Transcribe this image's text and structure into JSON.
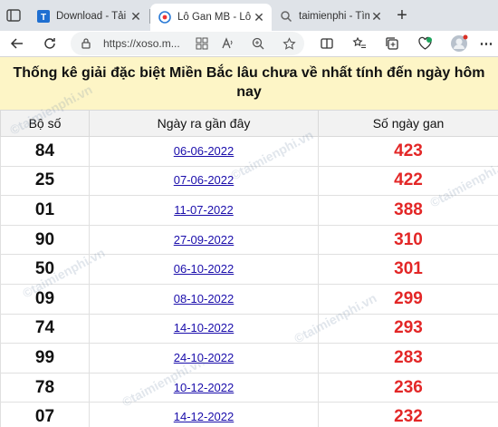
{
  "browser": {
    "tabs": [
      {
        "title": "Download - Tải M",
        "active": false
      },
      {
        "title": "Lô Gan MB - Lô G",
        "active": true
      },
      {
        "title": "taimienphi - Tìm k",
        "active": false
      }
    ],
    "new_tab_label": "+",
    "url": "https://xoso.m..."
  },
  "page": {
    "heading": "Thống kê giải đặc biệt Miền Bắc lâu chưa về nhất tính đến ngày hôm nay",
    "columns": [
      "Bộ số",
      "Ngày ra gần đây",
      "Số ngày gan"
    ],
    "rows": [
      {
        "number": "84",
        "date": "06-06-2022",
        "days": "423"
      },
      {
        "number": "25",
        "date": "07-06-2022",
        "days": "422"
      },
      {
        "number": "01",
        "date": "11-07-2022",
        "days": "388"
      },
      {
        "number": "90",
        "date": "27-09-2022",
        "days": "310"
      },
      {
        "number": "50",
        "date": "06-10-2022",
        "days": "301"
      },
      {
        "number": "09",
        "date": "08-10-2022",
        "days": "299"
      },
      {
        "number": "74",
        "date": "14-10-2022",
        "days": "293"
      },
      {
        "number": "99",
        "date": "24-10-2022",
        "days": "283"
      },
      {
        "number": "78",
        "date": "10-12-2022",
        "days": "236"
      },
      {
        "number": "07",
        "date": "14-12-2022",
        "days": "232"
      }
    ],
    "watermark": "©taimienphi.vn"
  },
  "colors": {
    "heading_bg": "#fdf5c6",
    "gan_red": "#e32727",
    "link_blue": "#1a0dab"
  }
}
